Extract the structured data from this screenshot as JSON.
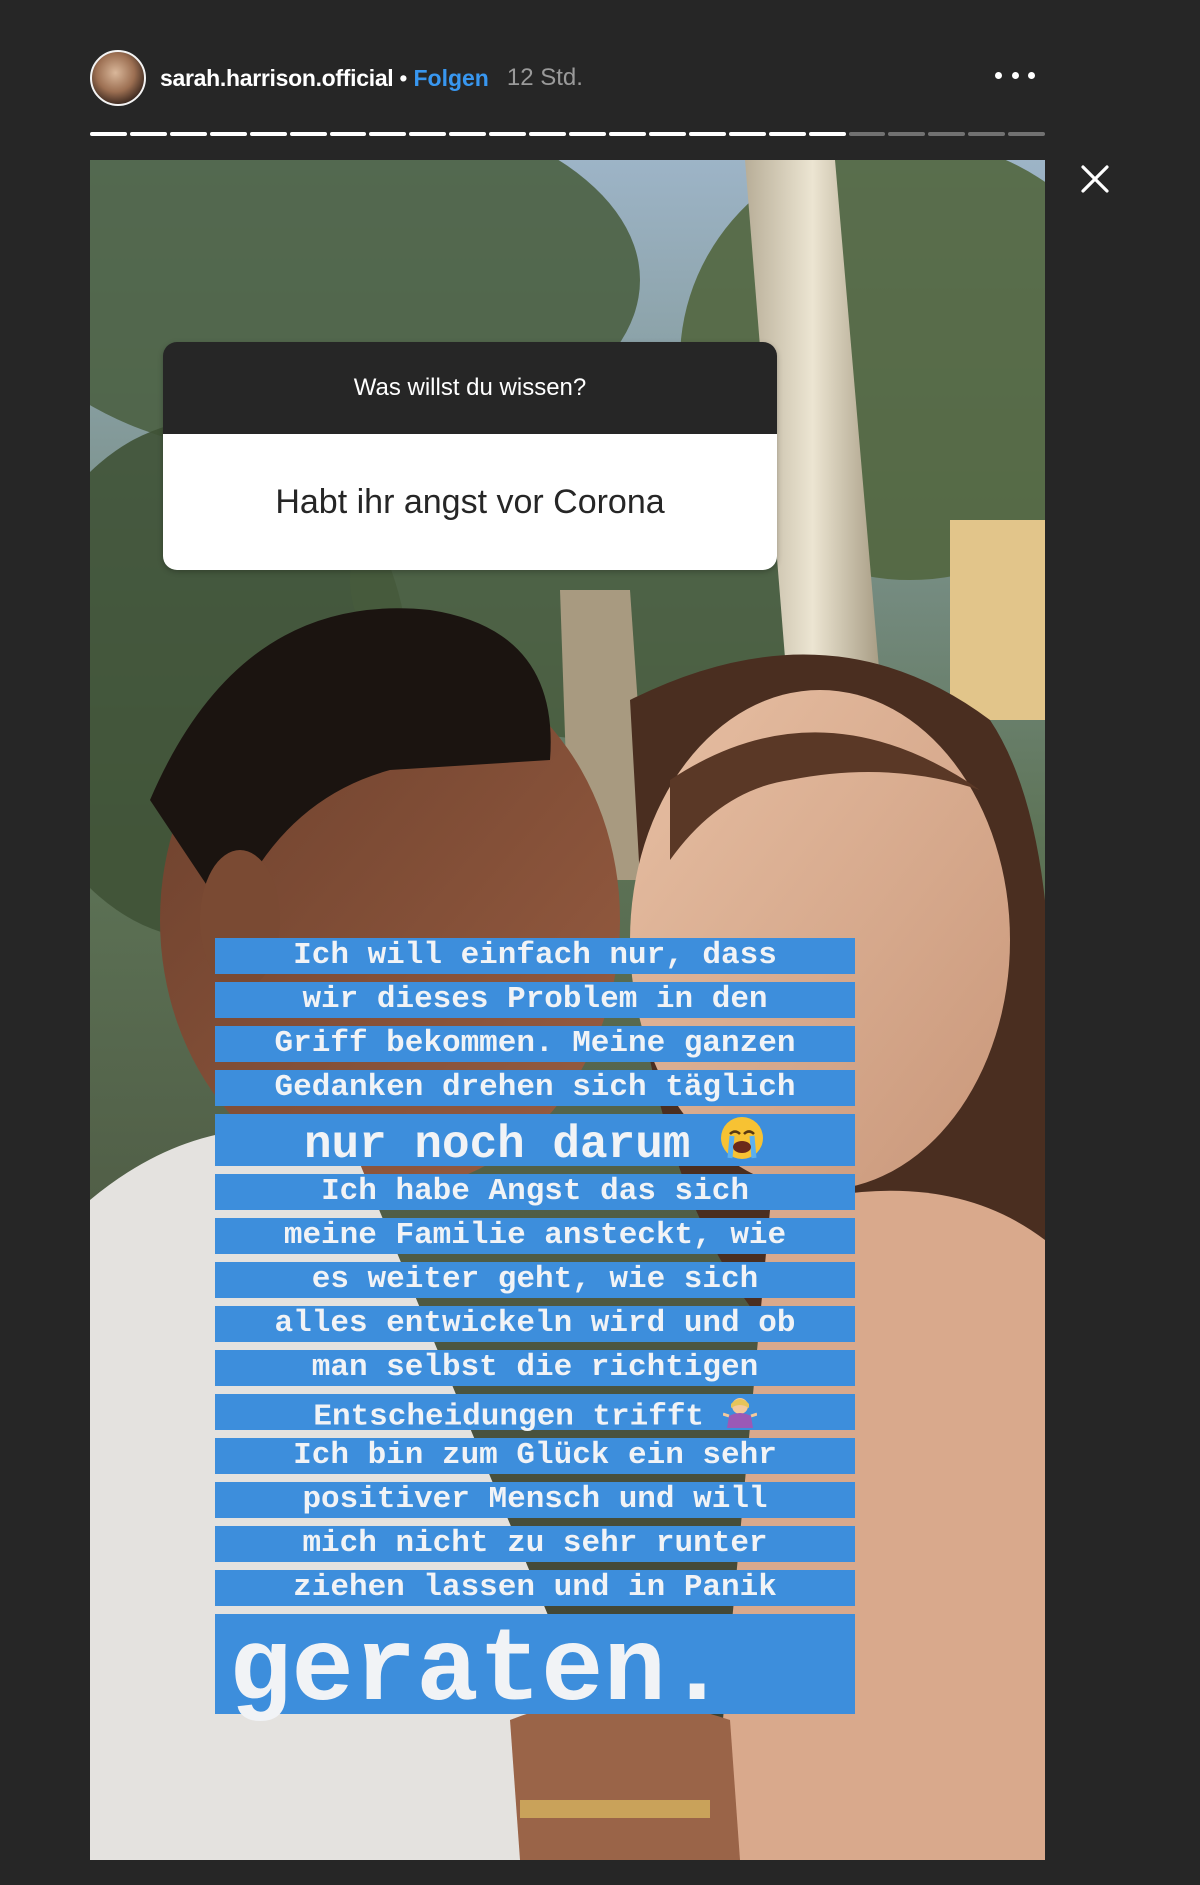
{
  "header": {
    "username": "sarah.harrison.official",
    "separator": "•",
    "follow_label": "Folgen",
    "time": "12 Std."
  },
  "progress": {
    "segments_total": 24,
    "segments_done": 19
  },
  "question_sticker": {
    "prompt": "Was willst du wissen?",
    "question": "Habt ihr angst vor Corona"
  },
  "caption": {
    "lines": [
      "Ich will einfach nur, dass",
      "wir dieses Problem in den",
      "Griff bekommen. Meine ganzen",
      "Gedanken drehen sich täglich",
      "nur noch darum",
      "Ich habe Angst das sich",
      "meine Familie ansteckt, wie",
      "es weiter geht, wie sich",
      "alles entwickeln wird und ob",
      "man selbst die richtigen",
      "Entscheidungen trifft",
      "Ich bin zum Glück ein sehr",
      "positiver Mensch und will",
      "mich nicht zu sehr runter",
      "ziehen lassen und in Panik",
      "geraten."
    ]
  },
  "icons": {
    "more": "more-horizontal-icon",
    "close": "close-icon",
    "crying_emoji": "loudly-crying-face-emoji",
    "shrug_emoji": "woman-shrugging-emoji"
  },
  "colors": {
    "background": "#262626",
    "accent_follow": "#3897f0",
    "caption_highlight": "#3d8edc"
  }
}
